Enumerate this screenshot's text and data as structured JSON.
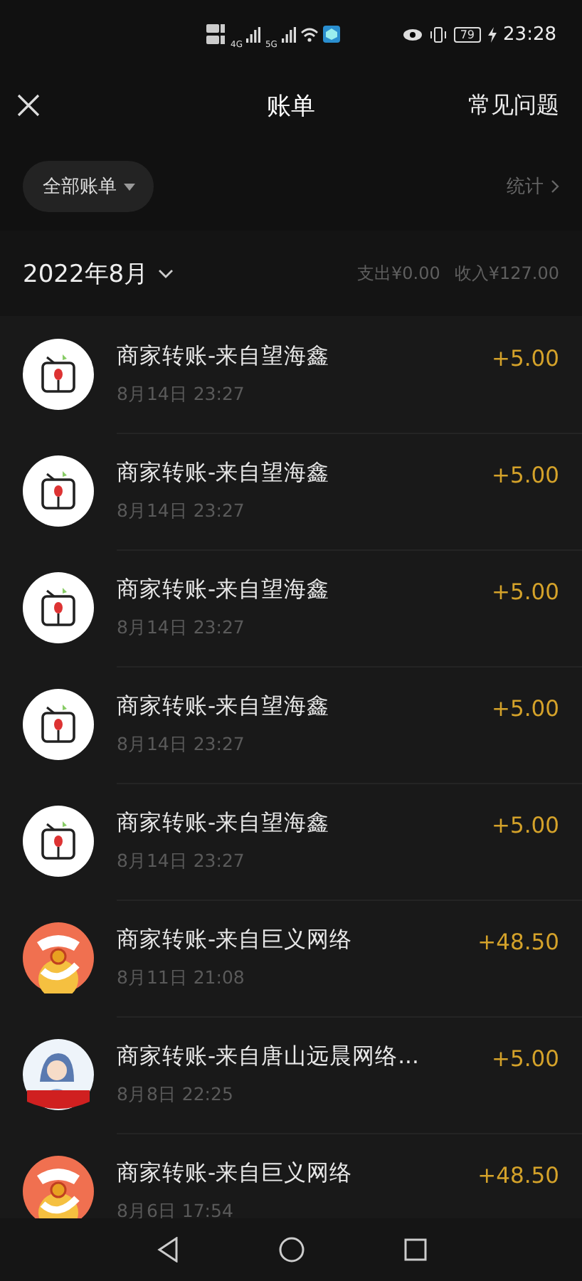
{
  "status_bar": {
    "signal_1": "4G",
    "signal_2": "5G",
    "battery": "79",
    "time": "23:28"
  },
  "header": {
    "title": "账单",
    "help": "常见问题"
  },
  "filter": {
    "label": "全部账单",
    "stats": "统计"
  },
  "month": {
    "label": "2022年8月",
    "expense": "支出¥0.00",
    "income": "收入¥127.00"
  },
  "transactions": [
    {
      "kind": "tv",
      "title": "商家转账-来自望海鑫",
      "time": "8月14日 23:27",
      "amount": "+5.00"
    },
    {
      "kind": "tv",
      "title": "商家转账-来自望海鑫",
      "time": "8月14日 23:27",
      "amount": "+5.00"
    },
    {
      "kind": "tv",
      "title": "商家转账-来自望海鑫",
      "time": "8月14日 23:27",
      "amount": "+5.00"
    },
    {
      "kind": "tv",
      "title": "商家转账-来自望海鑫",
      "time": "8月14日 23:27",
      "amount": "+5.00"
    },
    {
      "kind": "tv",
      "title": "商家转账-来自望海鑫",
      "time": "8月14日 23:27",
      "amount": "+5.00"
    },
    {
      "kind": "reward",
      "title": "商家转账-来自巨义网络",
      "time": "8月11日 21:08",
      "amount": "+48.50"
    },
    {
      "kind": "figure",
      "title": "商家转账-来自唐山远晨网络...",
      "time": "8月8日 22:25",
      "amount": "+5.00"
    },
    {
      "kind": "reward",
      "title": "商家转账-来自巨义网络",
      "time": "8月6日 17:54",
      "amount": "+48.50"
    }
  ]
}
